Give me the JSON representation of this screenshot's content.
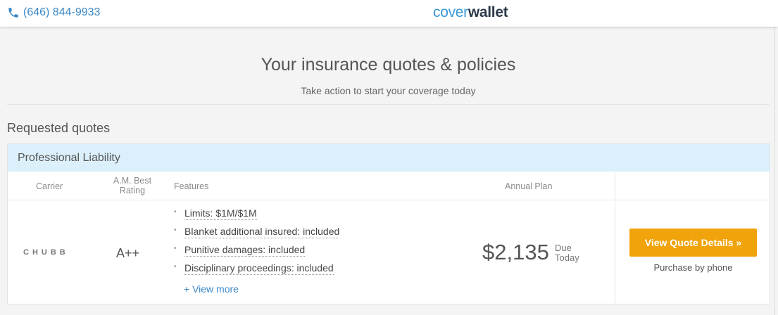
{
  "header": {
    "phone": "(646) 844-9933",
    "logo_part1": "cover",
    "logo_part2": "wallet"
  },
  "hero": {
    "title": "Your insurance quotes & policies",
    "subtitle": "Take action to start your coverage today"
  },
  "section": {
    "title": "Requested quotes"
  },
  "quote_card": {
    "category": "Professional Liability",
    "columns": {
      "carrier": "Carrier",
      "rating_line1": "A.M. Best",
      "rating_line2": "Rating",
      "features": "Features",
      "annual_plan": "Annual Plan"
    },
    "carrier": "CHUBB",
    "rating": "A++",
    "features": [
      "Limits: $1M/$1M",
      "Blanket additional insured: included",
      "Punitive damages: included",
      "Disciplinary proceedings: included"
    ],
    "view_more": "+ View more",
    "price": "$2,135",
    "due_line1": "Due",
    "due_line2": "Today",
    "cta_label": "View Quote Details »",
    "cta_sub": "Purchase by phone"
  },
  "colors": {
    "accent": "#3a87c8",
    "cta": "#f0a30a",
    "card_header": "#dcf0fc"
  }
}
